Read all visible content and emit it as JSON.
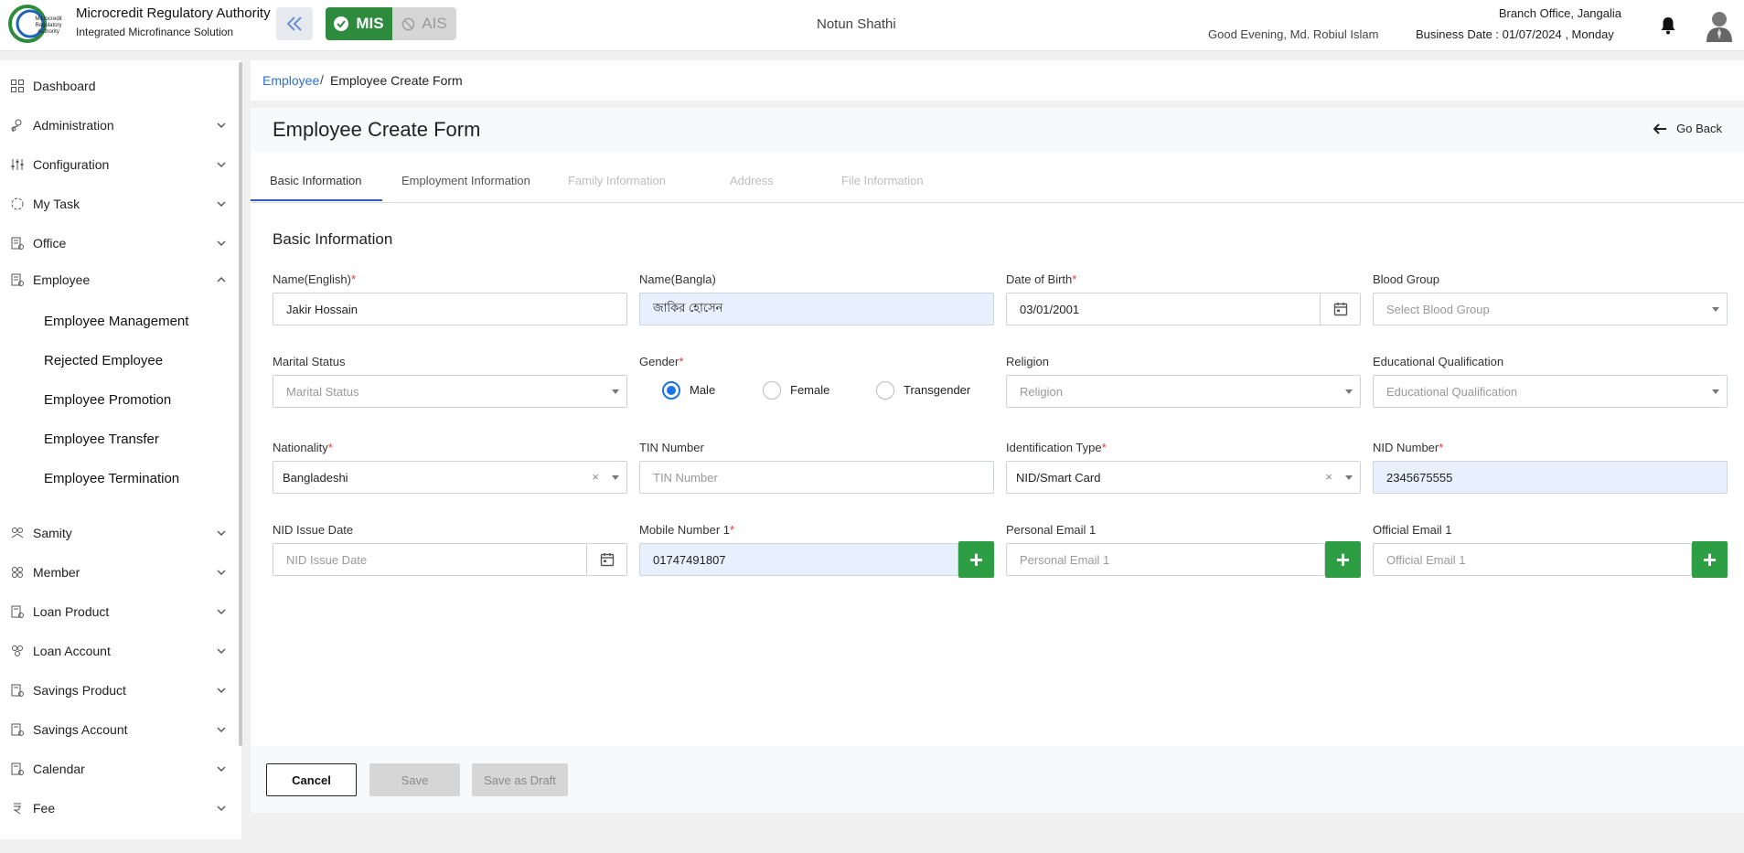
{
  "header": {
    "brand_title": "Microcredit Regulatory Authority",
    "brand_subtitle": "Integrated Microfinance Solution",
    "logo_text": "Microcredit Regulatory Authority",
    "mis_label": "MIS",
    "ais_label": "AIS",
    "org_name": "Notun Shathi",
    "greeting": "Good Evening, Md. Robiul Islam",
    "branch": "Branch Office, Jangalia",
    "business_date": "Business Date : 01/07/2024 , Monday",
    "colors": {
      "mis_green": "#2e8b3e",
      "accent_blue": "#2f6fd4"
    }
  },
  "sidebar": {
    "items": [
      {
        "label": "Dashboard",
        "icon": "dashboard-icon"
      },
      {
        "label": "Administration",
        "icon": "admin-icon"
      },
      {
        "label": "Configuration",
        "icon": "sliders-icon"
      },
      {
        "label": "My Task",
        "icon": "task-icon"
      },
      {
        "label": "Office",
        "icon": "office-icon"
      },
      {
        "label": "Employee",
        "icon": "employee-icon",
        "expanded": true
      },
      {
        "label": "Samity",
        "icon": "samity-icon"
      },
      {
        "label": "Member",
        "icon": "member-icon"
      },
      {
        "label": "Loan Product",
        "icon": "loan-product-icon"
      },
      {
        "label": "Loan Account",
        "icon": "loan-account-icon"
      },
      {
        "label": "Savings Product",
        "icon": "savings-product-icon"
      },
      {
        "label": "Savings Account",
        "icon": "savings-account-icon"
      },
      {
        "label": "Calendar",
        "icon": "calendar-icon"
      },
      {
        "label": "Fee",
        "icon": "fee-icon"
      }
    ],
    "employee_sub": [
      "Employee Management",
      "Rejected Employee",
      "Employee Promotion",
      "Employee Transfer",
      "Employee Termination"
    ]
  },
  "breadcrumb": {
    "parent": "Employee",
    "separator": "/",
    "current": "Employee Create Form"
  },
  "page": {
    "title": "Employee Create Form",
    "go_back": "Go Back"
  },
  "tabs": [
    {
      "label": "Basic Information",
      "active": true
    },
    {
      "label": "Employment Information",
      "active": false
    },
    {
      "label": "Family Information",
      "disabled": true
    },
    {
      "label": "Address",
      "disabled": true
    },
    {
      "label": "File Information",
      "disabled": true
    }
  ],
  "form": {
    "section_title": "Basic Information",
    "name_en": {
      "label": "Name(English)",
      "value": "Jakir Hossain"
    },
    "name_bn": {
      "label": "Name(Bangla)",
      "value": "জাকির হোসেন"
    },
    "dob": {
      "label": "Date of Birth",
      "value": "03/01/2001"
    },
    "blood_group": {
      "label": "Blood Group",
      "placeholder": "Select Blood Group"
    },
    "marital_status": {
      "label": "Marital Status",
      "placeholder": "Marital Status"
    },
    "gender": {
      "label": "Gender",
      "options": [
        "Male",
        "Female",
        "Transgender"
      ],
      "selected": "Male"
    },
    "religion": {
      "label": "Religion",
      "placeholder": "Religion"
    },
    "education": {
      "label": "Educational Qualification",
      "placeholder": "Educational Qualification"
    },
    "nationality": {
      "label": "Nationality",
      "value": "Bangladeshi"
    },
    "tin": {
      "label": "TIN Number",
      "placeholder": "TIN Number"
    },
    "id_type": {
      "label": "Identification Type",
      "value": "NID/Smart Card"
    },
    "nid_number": {
      "label": "NID Number",
      "value": "2345675555"
    },
    "nid_issue_date": {
      "label": "NID Issue Date",
      "placeholder": "NID Issue Date"
    },
    "mobile": {
      "label": "Mobile Number 1",
      "value": "01747491807"
    },
    "personal_email": {
      "label": "Personal Email 1",
      "placeholder": "Personal Email 1"
    },
    "official_email": {
      "label": "Official Email 1",
      "placeholder": "Official Email 1"
    },
    "required_mark": "*",
    "clear_glyph": "×",
    "plus_glyph": "+"
  },
  "footer": {
    "cancel": "Cancel",
    "save": "Save",
    "save_draft": "Save as Draft"
  }
}
